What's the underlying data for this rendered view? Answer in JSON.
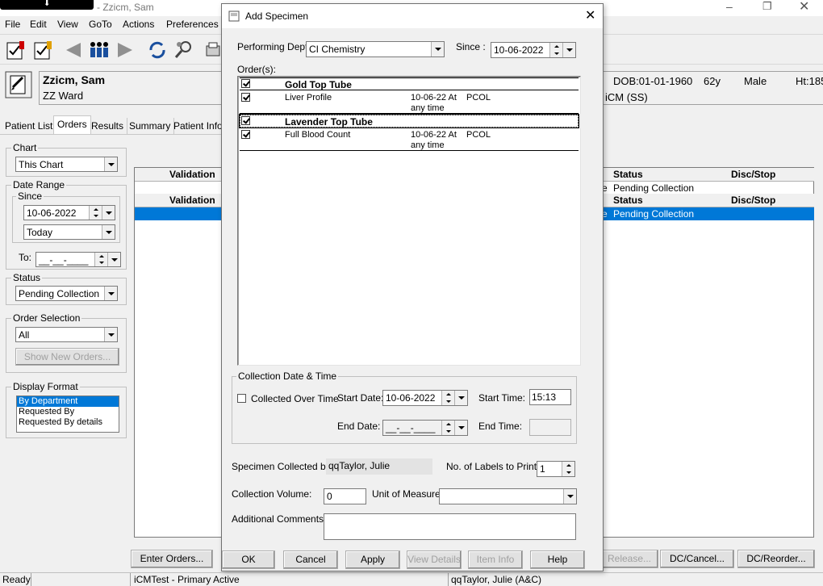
{
  "window": {
    "title": "- Zzicm, Sam"
  },
  "menu": [
    "File",
    "Edit",
    "View",
    "GoTo",
    "Actions",
    "Preferences"
  ],
  "patient": {
    "name": "Zzicm, Sam",
    "ward": "ZZ Ward",
    "dob": "DOB:01-01-1960",
    "age": "62y",
    "sex": "Male",
    "height": "Ht:185",
    "system": "iCM (SS)"
  },
  "tabs": [
    "Patient List",
    "Orders",
    "Results",
    "Summary",
    "Patient Info"
  ],
  "sidebar": {
    "chart": {
      "label": "Chart",
      "value": "This Chart"
    },
    "date_range": {
      "label": "Date Range",
      "since_label": "Since",
      "since_value": "10-06-2022",
      "period": "Today",
      "to_label": "To:",
      "to_value": "__-__-____"
    },
    "status": {
      "label": "Status",
      "value": "Pending Collection"
    },
    "order_selection": {
      "label": "Order Selection",
      "value": "All",
      "show_new_label": "Show New Orders..."
    },
    "display_format": {
      "label": "Display Format",
      "options": [
        "By Department",
        "Requested By",
        "Requested By details"
      ]
    }
  },
  "grid": {
    "validation": "Validation",
    "status": "Status",
    "disc_stop": "Disc/Stop",
    "row1_prefix": "e",
    "row1_status": "Pending Collection",
    "row2_prefix": "e",
    "row2_status": "Pending Collection"
  },
  "bottom_buttons": {
    "enter_orders": "Enter Orders...",
    "release": "Release...",
    "dc_cancel": "DC/Cancel...",
    "dc_reorder": "DC/Reorder..."
  },
  "statusbar": {
    "ready": "Ready",
    "env": "iCMTest - Primary Active",
    "user": "qqTaylor, Julie (A&C)"
  },
  "dialog": {
    "title": "Add Specimen",
    "performing_dept_label": "Performing Dept.",
    "performing_dept": "CI Chemistry",
    "since_label": "Since :",
    "since_value": "10-06-2022",
    "orders_label": "Order(s):",
    "orders": [
      {
        "group": "Gold Top Tube",
        "item": "Liver Profile",
        "date": "10-06-22 At",
        "time": "any time",
        "status": "PCOL"
      },
      {
        "group": "Lavender Top Tube",
        "item": "Full Blood Count",
        "date": "10-06-22 At",
        "time": "any time",
        "status": "PCOL"
      }
    ],
    "collection_group": "Collection Date & Time",
    "collected_over_time": "Collected Over Time",
    "start_date_label": "Start Date:",
    "start_date": "10-06-2022",
    "start_time_label": "Start Time:",
    "start_time": "15:13",
    "end_date_label": "End Date:",
    "end_date": "__-__-____",
    "end_time_label": "End Time:",
    "end_time": "",
    "collected_by_label": "Specimen Collected by:",
    "collected_by": "qqTaylor, Julie",
    "labels_label": "No. of Labels to Print:",
    "labels_value": "1",
    "volume_label": "Collection Volume:",
    "volume_value": "0",
    "unit_label": "Unit of Measure:",
    "unit_value": "",
    "comments_label": "Additional Comments:",
    "comments_value": "",
    "buttons": {
      "ok": "OK",
      "cancel": "Cancel",
      "apply": "Apply",
      "view_details": "View Details",
      "item_info": "Item Info",
      "help": "Help"
    }
  },
  "colors": {
    "selection": "#0078d7",
    "bg": "#f0f0f0"
  }
}
